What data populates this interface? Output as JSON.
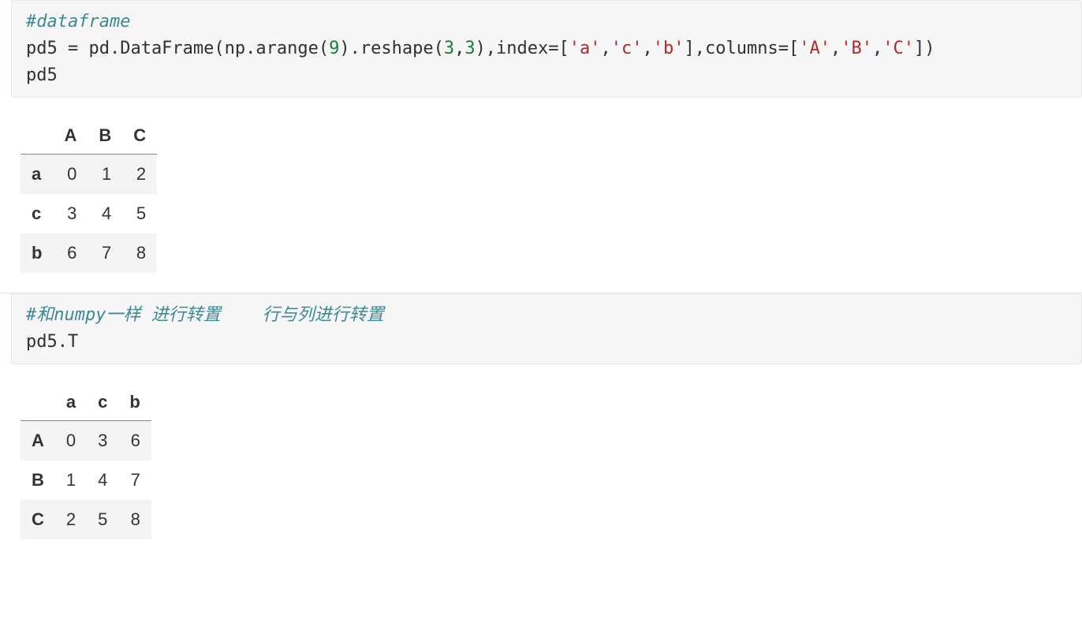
{
  "cell1": {
    "code_comment": "#dataframe",
    "code_line1_a": "pd5 = pd.DataFrame(np.arange(",
    "code_line1_num1": "9",
    "code_line1_b": ").reshape(",
    "code_line1_num2": "3",
    "code_line1_c": ",",
    "code_line1_num3": "3",
    "code_line1_d": "),index=[",
    "code_line1_s1": "'a'",
    "code_line1_e": ",",
    "code_line1_s2": "'c'",
    "code_line1_f": ",",
    "code_line1_s3": "'b'",
    "code_line1_g": "],columns=[",
    "code_line1_s4": "'A'",
    "code_line1_h": ",",
    "code_line1_s5": "'B'",
    "code_line1_i": ",",
    "code_line1_s6": "'C'",
    "code_line1_j": "])",
    "code_line2": "pd5"
  },
  "table1": {
    "columns": [
      "A",
      "B",
      "C"
    ],
    "index": [
      "a",
      "c",
      "b"
    ],
    "rows": [
      [
        "0",
        "1",
        "2"
      ],
      [
        "3",
        "4",
        "5"
      ],
      [
        "6",
        "7",
        "8"
      ]
    ]
  },
  "cell2": {
    "code_comment": "#和numpy一样 进行转置    行与列进行转置",
    "code_line1": "pd5.T"
  },
  "table2": {
    "columns": [
      "a",
      "c",
      "b"
    ],
    "index": [
      "A",
      "B",
      "C"
    ],
    "rows": [
      [
        "0",
        "3",
        "6"
      ],
      [
        "1",
        "4",
        "7"
      ],
      [
        "2",
        "5",
        "8"
      ]
    ]
  }
}
